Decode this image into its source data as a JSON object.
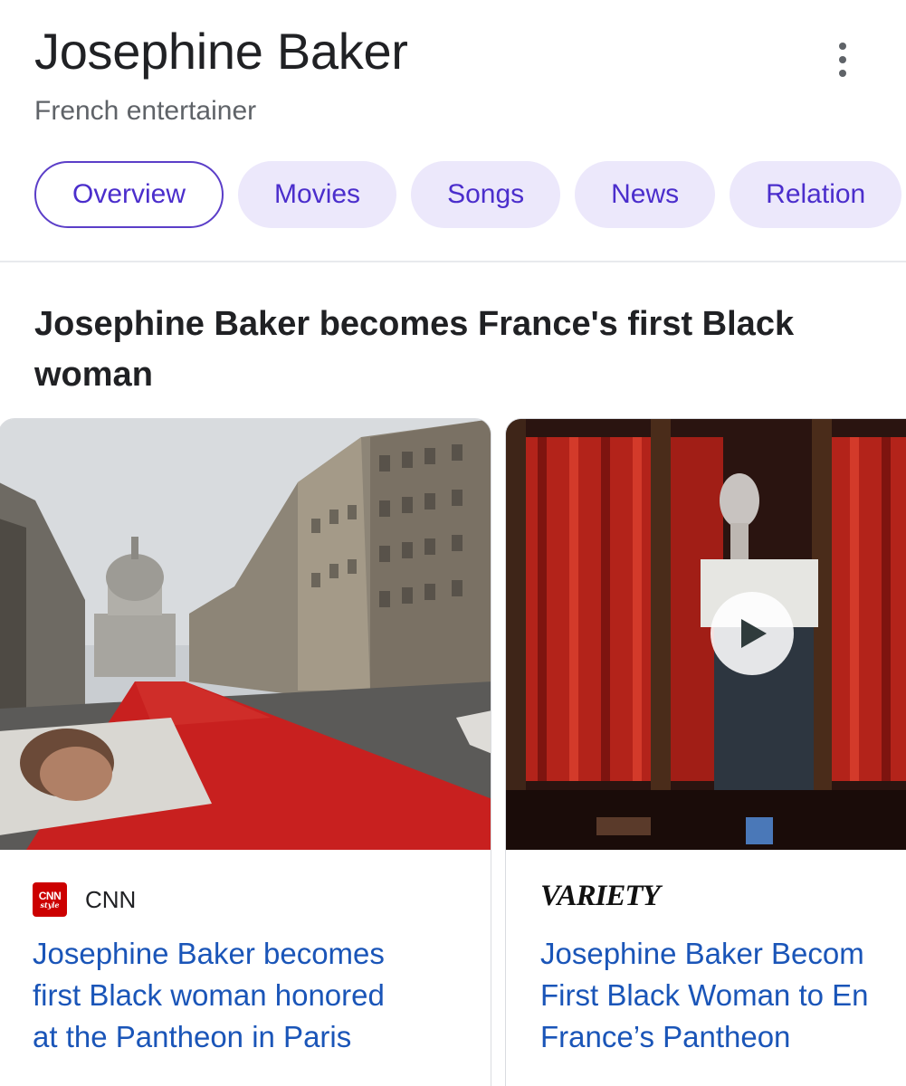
{
  "entity": {
    "title": "Josephine Baker",
    "subtitle": "French entertainer"
  },
  "more_icon": "more-vertical-icon",
  "chips": [
    {
      "label": "Overview",
      "active": true
    },
    {
      "label": "Movies",
      "active": false
    },
    {
      "label": "Songs",
      "active": false
    },
    {
      "label": "News",
      "active": false
    },
    {
      "label": "Relation",
      "active": false
    }
  ],
  "section": {
    "heading": "Josephine Baker becomes France's first Black woman"
  },
  "cards": [
    {
      "source": "CNN",
      "source_logo_text": "CNN",
      "source_logo_subtext": "style",
      "headline_lines": [
        "Josephine Baker becomes",
        "first Black woman honored",
        "at the Pantheon in Paris"
      ]
    },
    {
      "source": "VARIETY",
      "headline_lines": [
        "Josephine Baker Becom",
        "First Black Woman to En",
        "France’s Pantheon"
      ],
      "has_video": true
    }
  ],
  "colors": {
    "chip_text": "#4b2ecc",
    "chip_bg": "#ece8fb",
    "chip_active_border": "#5b3ec8",
    "link": "#1a55b8",
    "cnn_red": "#cc0000"
  }
}
